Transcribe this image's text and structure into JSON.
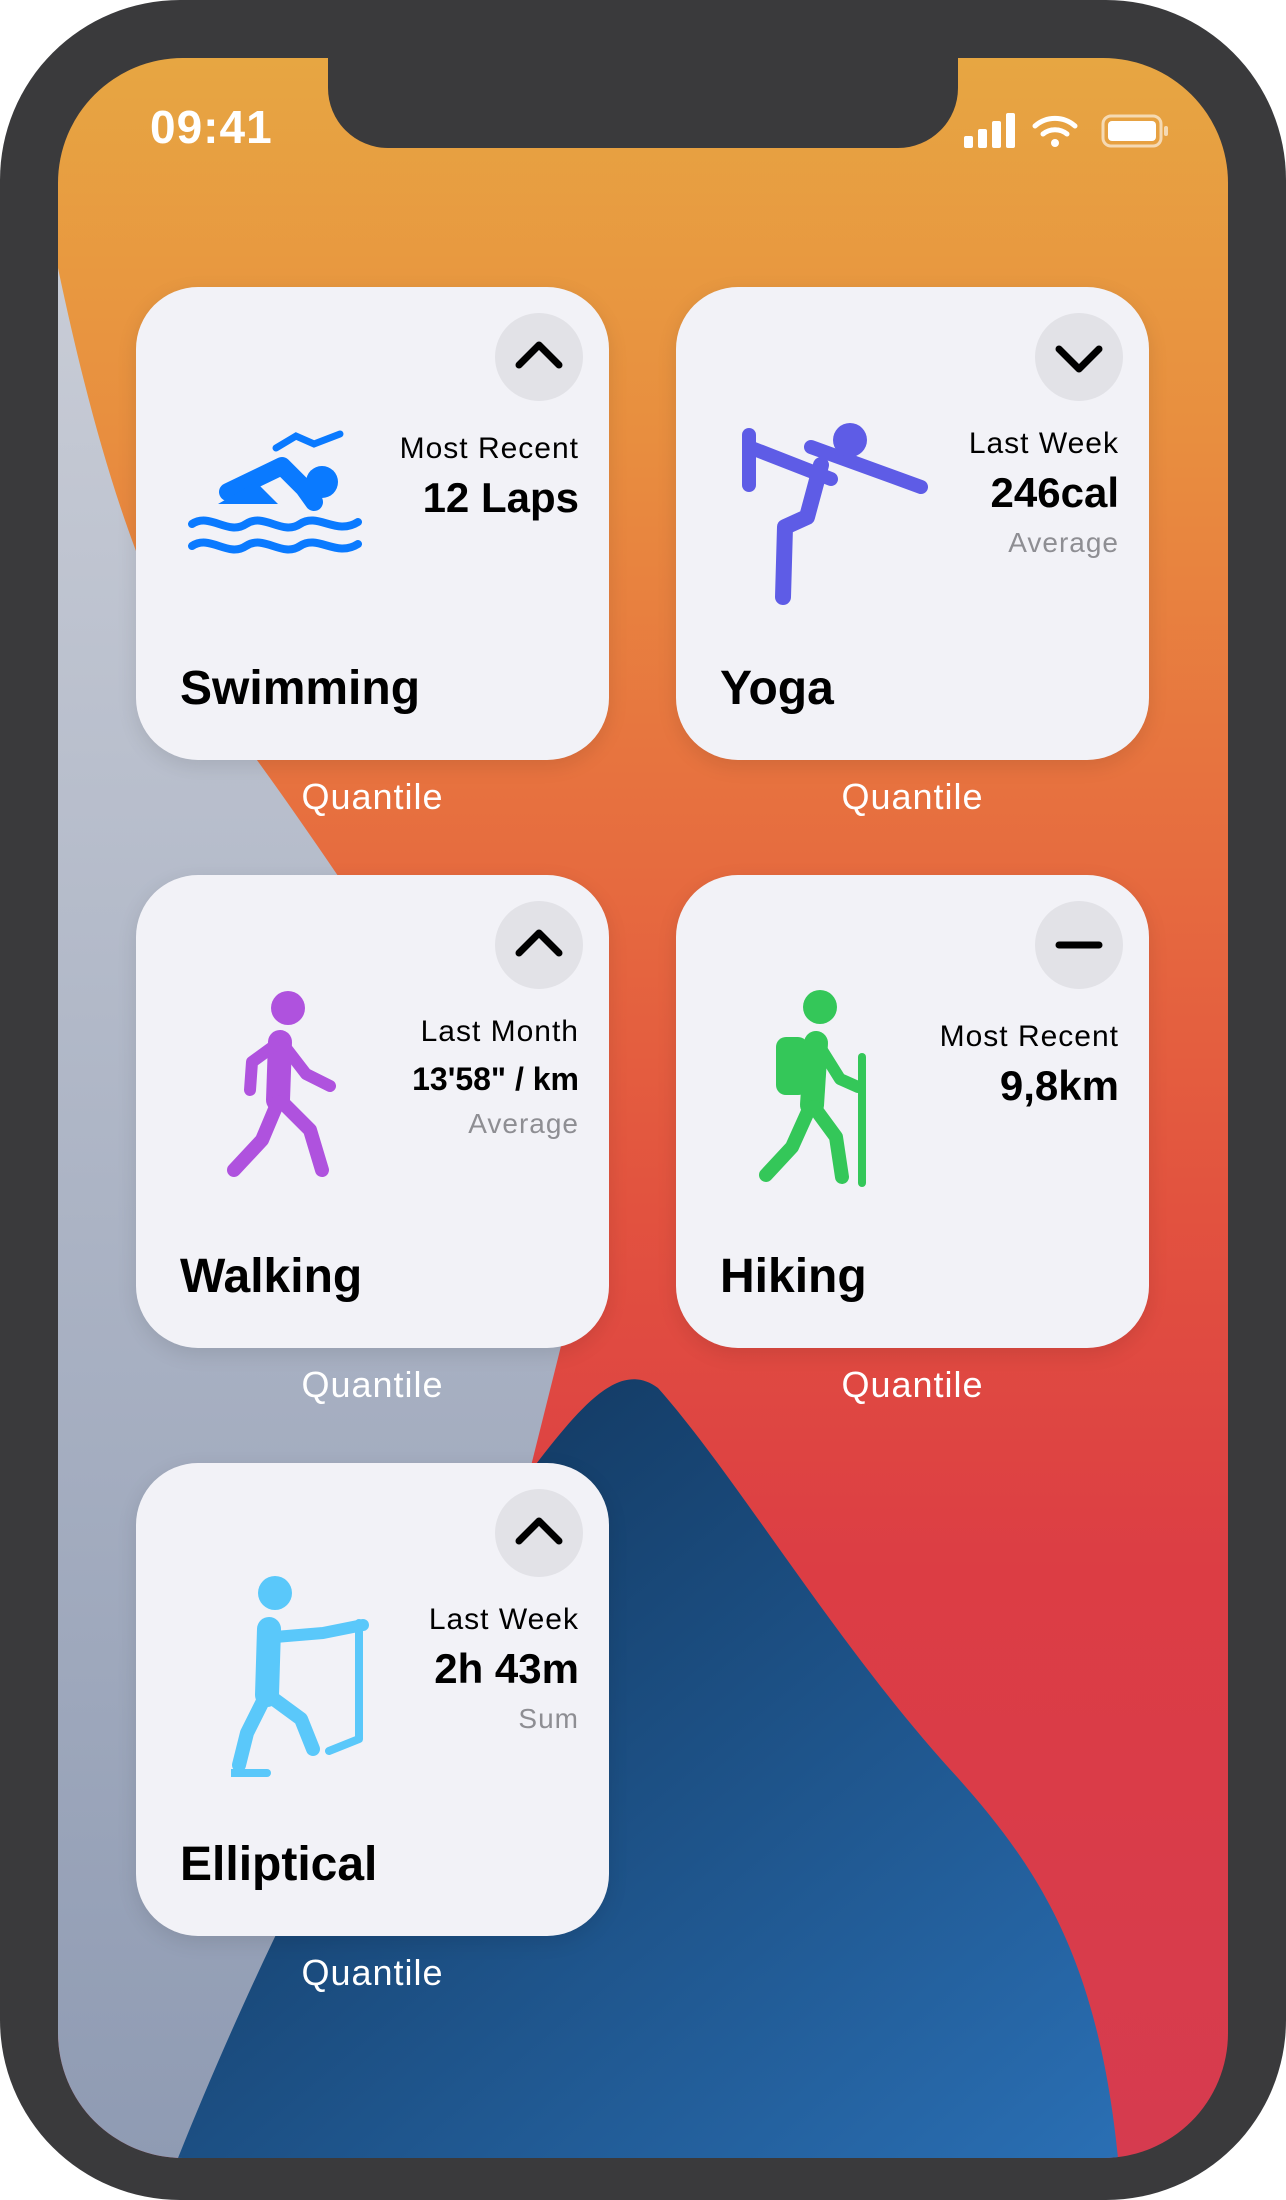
{
  "status_bar": {
    "time": "09:41"
  },
  "colors": {
    "swimming": "#0a7aff",
    "yoga": "#5e5ce6",
    "walking": "#af52de",
    "hiking": "#34c759",
    "elliptical": "#5ac8fa",
    "card_background": "#f2f2f7"
  },
  "widgets": [
    {
      "title": "Swimming",
      "icon": "swimming-icon",
      "trend": "up",
      "period": "Most Recent",
      "value": "12 Laps",
      "note": "",
      "caption": "Quantile"
    },
    {
      "title": "Yoga",
      "icon": "yoga-icon",
      "trend": "down",
      "period": "Last Week",
      "value": "246cal",
      "note": "Average",
      "caption": "Quantile"
    },
    {
      "title": "Walking",
      "icon": "walking-icon",
      "trend": "up",
      "period": "Last Month",
      "value": "13'58\" / km",
      "note": "Average",
      "caption": "Quantile"
    },
    {
      "title": "Hiking",
      "icon": "hiking-icon",
      "trend": "flat",
      "period": "Most Recent",
      "value": "9,8km",
      "note": "",
      "caption": "Quantile"
    },
    {
      "title": "Elliptical",
      "icon": "elliptical-icon",
      "trend": "up",
      "period": "Last Week",
      "value": "2h 43m",
      "note": "Sum",
      "caption": "Quantile"
    }
  ]
}
